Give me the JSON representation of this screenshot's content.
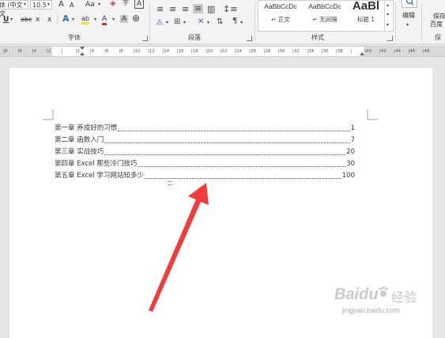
{
  "ribbon": {
    "font": {
      "font_name": "宋体 (中文正文",
      "font_size": "10.5",
      "grow_font": "A",
      "shrink_font": "A",
      "change_case": "Aa",
      "clear_format": "A",
      "char_border": "A",
      "underline": "U",
      "strikethrough": "abc",
      "subscript": "x",
      "superscript": "x",
      "text_effect": "A",
      "highlight": "ab",
      "font_color": "A",
      "char_shading": "A",
      "enclose": "字",
      "group_label": "字体"
    },
    "paragraph": {
      "group_label": "段落"
    },
    "styles": {
      "items": [
        {
          "preview": "AaBbCcDc",
          "name": "↵ 正文"
        },
        {
          "preview": "AaBbCcDc",
          "name": "↵ 无间隔"
        },
        {
          "preview": "AaBl",
          "name": "标题 1"
        }
      ],
      "group_label": "样式"
    },
    "editing": {
      "label": "编辑"
    },
    "save": {
      "label_line1": "保存",
      "label_line2": "百度",
      "group_label": "保"
    }
  },
  "ruler": {
    "ticks": [
      "8",
      "6",
      "4",
      "2",
      "",
      "2",
      "4",
      "6",
      "8",
      "10",
      "12",
      "14",
      "16",
      "18",
      "20",
      "22",
      "24",
      "26",
      "28",
      "30",
      "32",
      "34",
      "36",
      "38",
      "",
      "40",
      "42",
      "44",
      "46",
      "48"
    ]
  },
  "document": {
    "toc": [
      {
        "title": "第一章 养成好的习惯",
        "page": "1"
      },
      {
        "title": "第二章 函数入门",
        "page": "7"
      },
      {
        "title": "第三章 实战技巧",
        "page": "20"
      },
      {
        "title": "第四章 Excel 那些冷门技巧",
        "page": "30"
      },
      {
        "title": "第五章 Excel 学习网站知多少",
        "page": "100"
      }
    ]
  },
  "watermark": {
    "brand": "Baidu",
    "brand_cn": "经验",
    "url": "jingyan.baidu.com"
  },
  "colors": {
    "arrow": "#f23b3b",
    "ribbon_bg": "#f3f3f3",
    "canvas_bg": "#e6e6e6"
  }
}
